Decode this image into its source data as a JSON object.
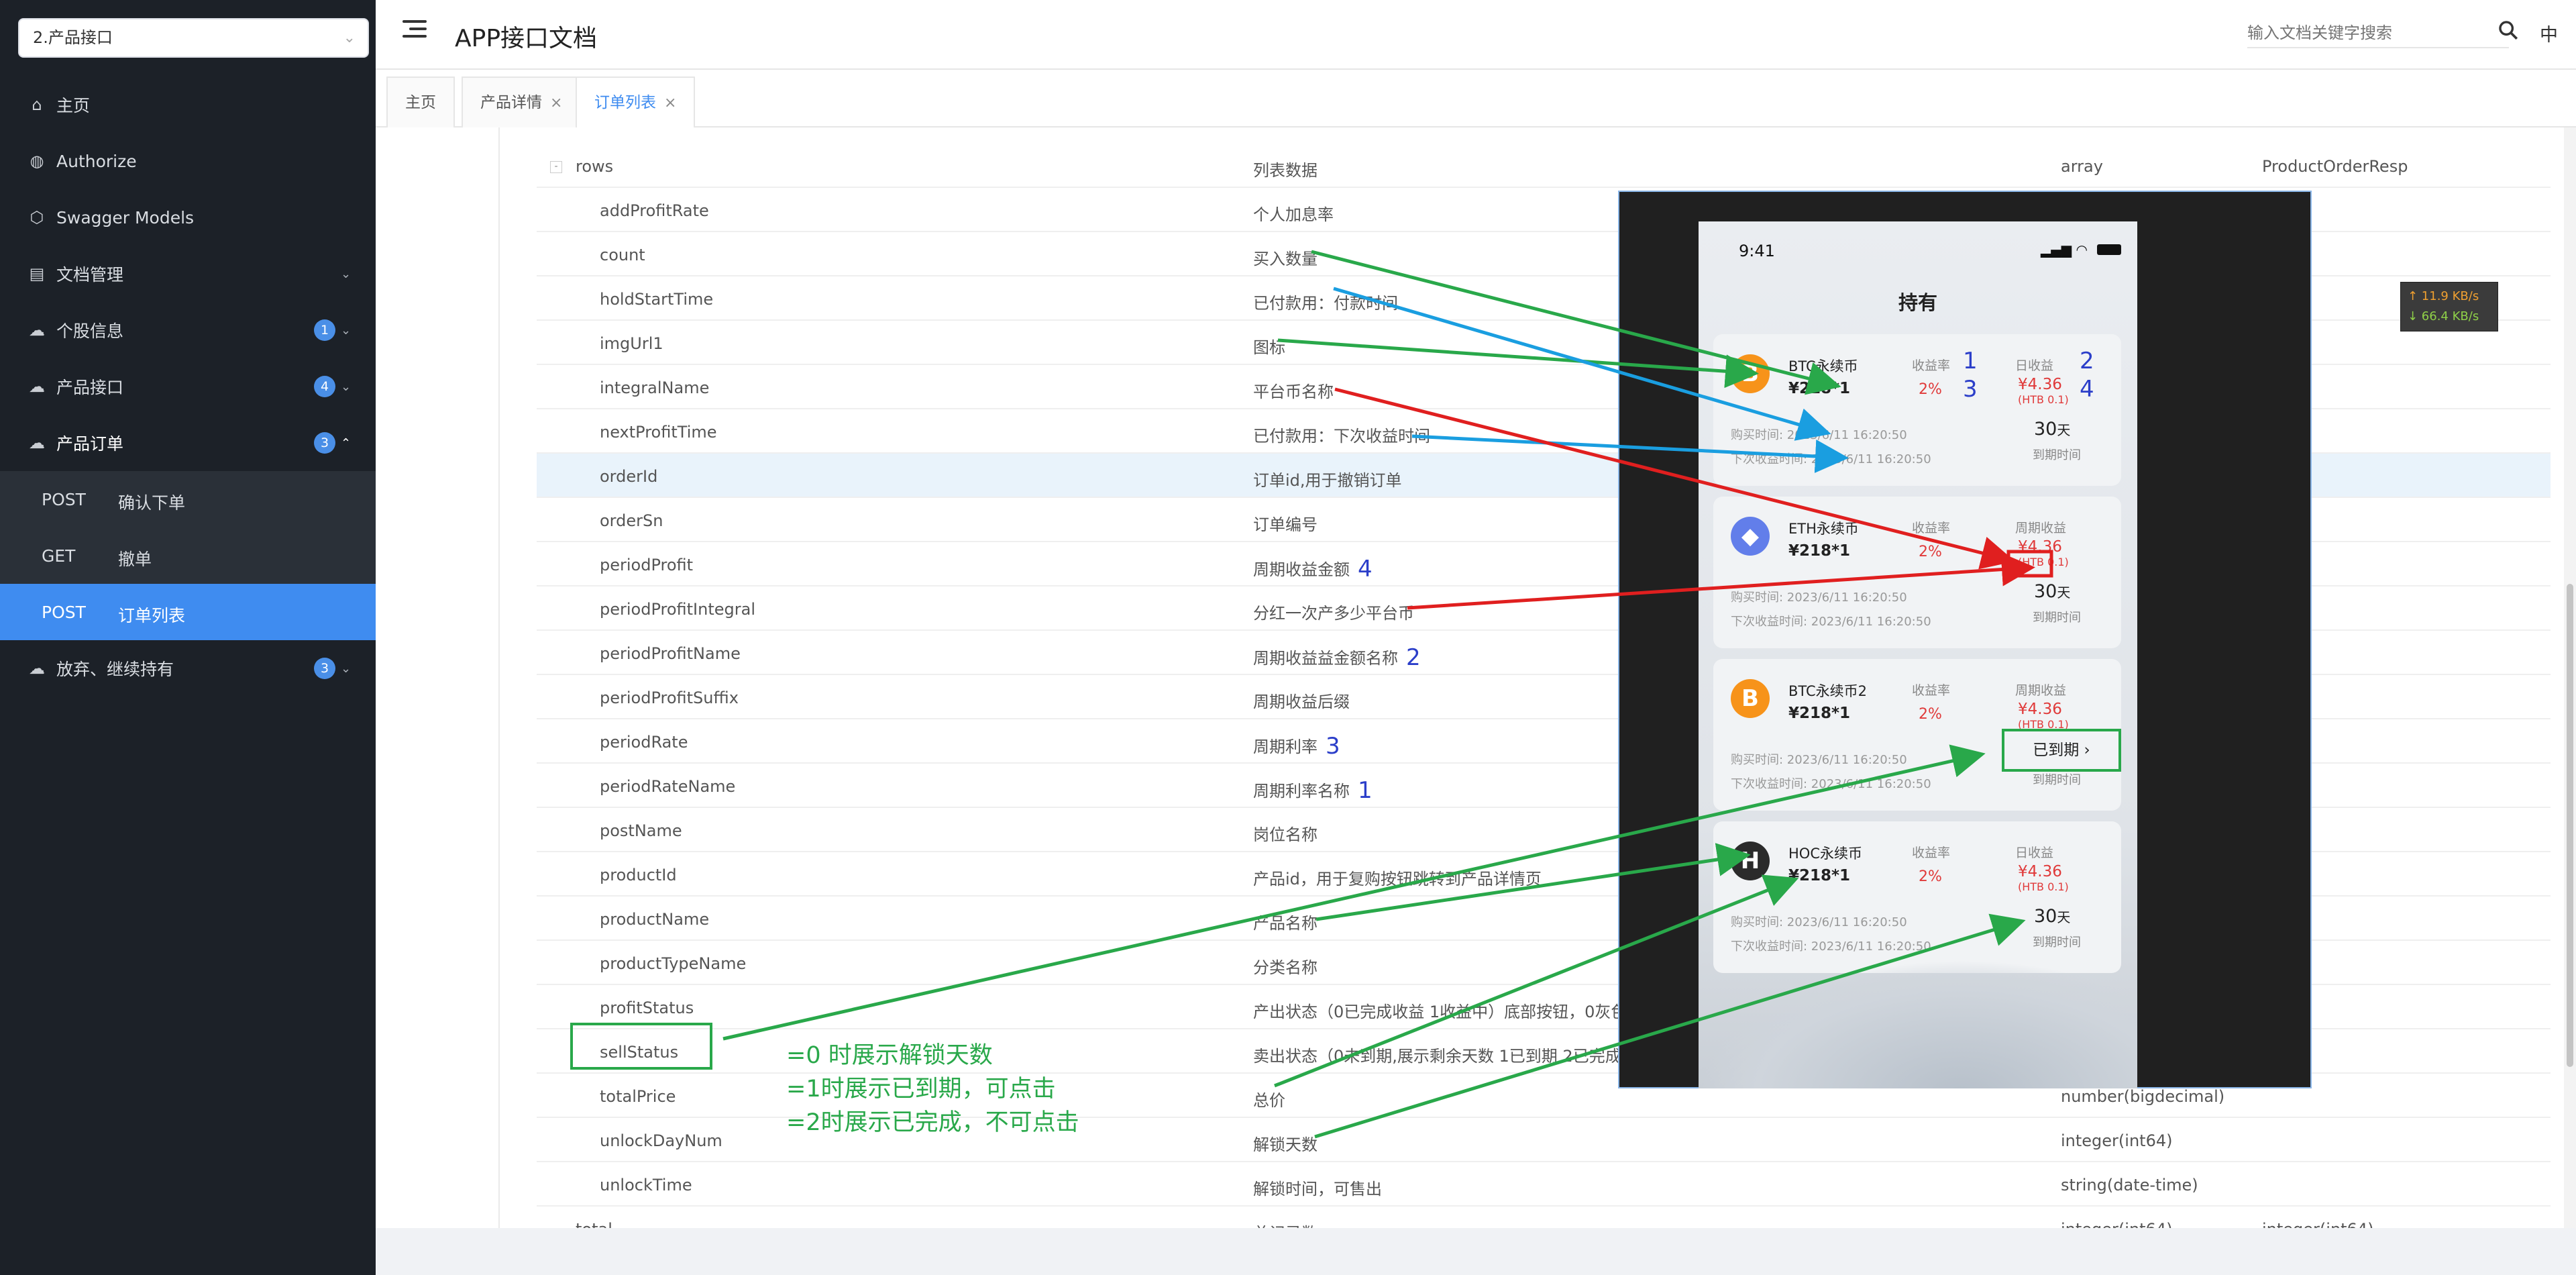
{
  "sidebar": {
    "group_select": "2.产品接口",
    "items": [
      {
        "label": "主页",
        "icon": "home-icon"
      },
      {
        "label": "Authorize",
        "icon": "lock-icon"
      },
      {
        "label": "Swagger Models",
        "icon": "cube-icon"
      },
      {
        "label": "文档管理",
        "icon": "document-icon"
      },
      {
        "label": "个股信息",
        "icon": "cloud-icon",
        "badge": "1"
      },
      {
        "label": "产品接口",
        "icon": "cloud-icon",
        "badge": "4"
      },
      {
        "label": "产品订单",
        "icon": "cloud-icon",
        "badge": "3"
      },
      {
        "label": "放弃、继续持有",
        "icon": "cloud-icon",
        "badge": "3"
      }
    ],
    "sub_items": [
      {
        "method": "POST",
        "label": "确认下单"
      },
      {
        "method": "GET",
        "label": "撤单"
      },
      {
        "method": "POST",
        "label": "订单列表"
      }
    ]
  },
  "header": {
    "title": "APP接口文档",
    "search_placeholder": "输入文档关键字搜索",
    "lang": "中"
  },
  "tabs": [
    {
      "label": "主页"
    },
    {
      "label": "产品详情",
      "close": "×"
    },
    {
      "label": "订单列表",
      "close": "×"
    }
  ],
  "table": {
    "rows": [
      {
        "name": "rows",
        "desc": "列表数据",
        "type": "array",
        "schema": "ProductOrderResp",
        "expander": "-"
      },
      {
        "name": "addProfitRate",
        "desc": "个人加息率"
      },
      {
        "name": "count",
        "desc": "买入数量"
      },
      {
        "name": "holdStartTime",
        "desc": "已付款用：付款时间"
      },
      {
        "name": "imgUrl1",
        "desc": "图标"
      },
      {
        "name": "integralName",
        "desc": "平台币名称"
      },
      {
        "name": "nextProfitTime",
        "desc": "已付款用：下次收益时间"
      },
      {
        "name": "orderId",
        "desc": "订单id,用于撤销订单"
      },
      {
        "name": "orderSn",
        "desc": "订单编号"
      },
      {
        "name": "periodProfit",
        "desc": "周期收益金额",
        "anno": "4"
      },
      {
        "name": "periodProfitIntegral",
        "desc": "分红一次产多少平台币"
      },
      {
        "name": "periodProfitName",
        "desc": "周期收益益金额名称",
        "anno": "2"
      },
      {
        "name": "periodProfitSuffix",
        "desc": "周期收益后缀"
      },
      {
        "name": "periodRate",
        "desc": "周期利率",
        "anno": "3"
      },
      {
        "name": "periodRateName",
        "desc": "周期利率名称",
        "anno": "1"
      },
      {
        "name": "postName",
        "desc": "岗位名称"
      },
      {
        "name": "productId",
        "desc": "产品id，用于复购按钮跳转到产品详情页"
      },
      {
        "name": "productName",
        "desc": "产品名称"
      },
      {
        "name": "productTypeName",
        "desc": "分类名称"
      },
      {
        "name": "profitStatus",
        "desc": "产出状态（0已完成收益 1收益中）底部按钮，0灰色"
      },
      {
        "name": "sellStatus",
        "desc": "卖出状态（0未到期,展示剩余天数 1已到期 2已完成"
      },
      {
        "name": "totalPrice",
        "desc": "总价",
        "type": "number(bigdecimal)"
      },
      {
        "name": "unlockDayNum",
        "desc": "解锁天数",
        "type": "integer(int64)"
      },
      {
        "name": "unlockTime",
        "desc": "解锁时间，可售出",
        "type": "string(date-time)"
      },
      {
        "name": "total",
        "desc": "总记录数",
        "type": "integer(int64)",
        "schema": "integer(int64)"
      }
    ]
  },
  "net_widget": {
    "up": "↑ 11.9 KB/s",
    "down": "↓ 66.4 KB/s"
  },
  "phone": {
    "time": "9:41",
    "status": "▂▄▆ ◠",
    "title": "持有",
    "cards": [
      {
        "coin": "B",
        "coin_color": "#f7931a",
        "name": "BTC永续币",
        "price": "¥218*1",
        "rate_label": "收益率",
        "rate": "2%",
        "profit_label": "日收益",
        "profit": "¥4.36",
        "htb": "(HTB 0.1)",
        "buy": "购买时间:   2023/6/11 16:20:50",
        "next": "下次收益时间:   2023/6/11 16:20:50",
        "days": "30",
        "days_unit": "天",
        "days_label": "到期时间",
        "n1": "1",
        "n2": "2",
        "n3": "3",
        "n4": "4"
      },
      {
        "coin": "◆",
        "coin_color": "#627eea",
        "name": "ETH永续币",
        "price": "¥218*1",
        "rate_label": "收益率",
        "rate": "2%",
        "profit_label": "周期收益",
        "profit": "¥4.36",
        "htb": "(HTB 0.1)",
        "buy": "购买时间:   2023/6/11 16:20:50",
        "next": "下次收益时间:   2023/6/11 16:20:50",
        "days": "30",
        "days_unit": "天",
        "days_label": "到期时间"
      },
      {
        "coin": "B",
        "coin_color": "#f7931a",
        "name": "BTC永续币2",
        "price": "¥218*1",
        "rate_label": "收益率",
        "rate": "2%",
        "profit_label": "周期收益",
        "profit": "¥4.36",
        "htb": "(HTB 0.1)",
        "buy": "购买时间:   2023/6/11 16:20:50",
        "next": "下次收益时间:   2023/6/11 16:20:50",
        "expired_btn": "已到期 ›",
        "days_label": "到期时间"
      },
      {
        "coin": "H",
        "coin_color": "#2b2b2b",
        "name": "HOC永续币",
        "price": "¥218*1",
        "rate_label": "收益率",
        "rate": "2%",
        "profit_label": "日收益",
        "profit": "¥4.36",
        "htb": "(HTB 0.1)",
        "buy": "购买时间:   2023/6/11 16:20:50",
        "next": "下次收益时间:   2023/6/11 16:20:50",
        "days": "30",
        "days_unit": "天",
        "days_label": "到期时间"
      }
    ]
  },
  "annotations": {
    "notes": [
      "=0 时展示解锁天数",
      "=1时展示已到期，可点击",
      "=2时展示已完成，不可点击"
    ],
    "colors": {
      "green": "#29a84a",
      "blue": "#1a9ee0",
      "red": "#e01f1f",
      "number_blue": "#2b3ec9"
    }
  }
}
